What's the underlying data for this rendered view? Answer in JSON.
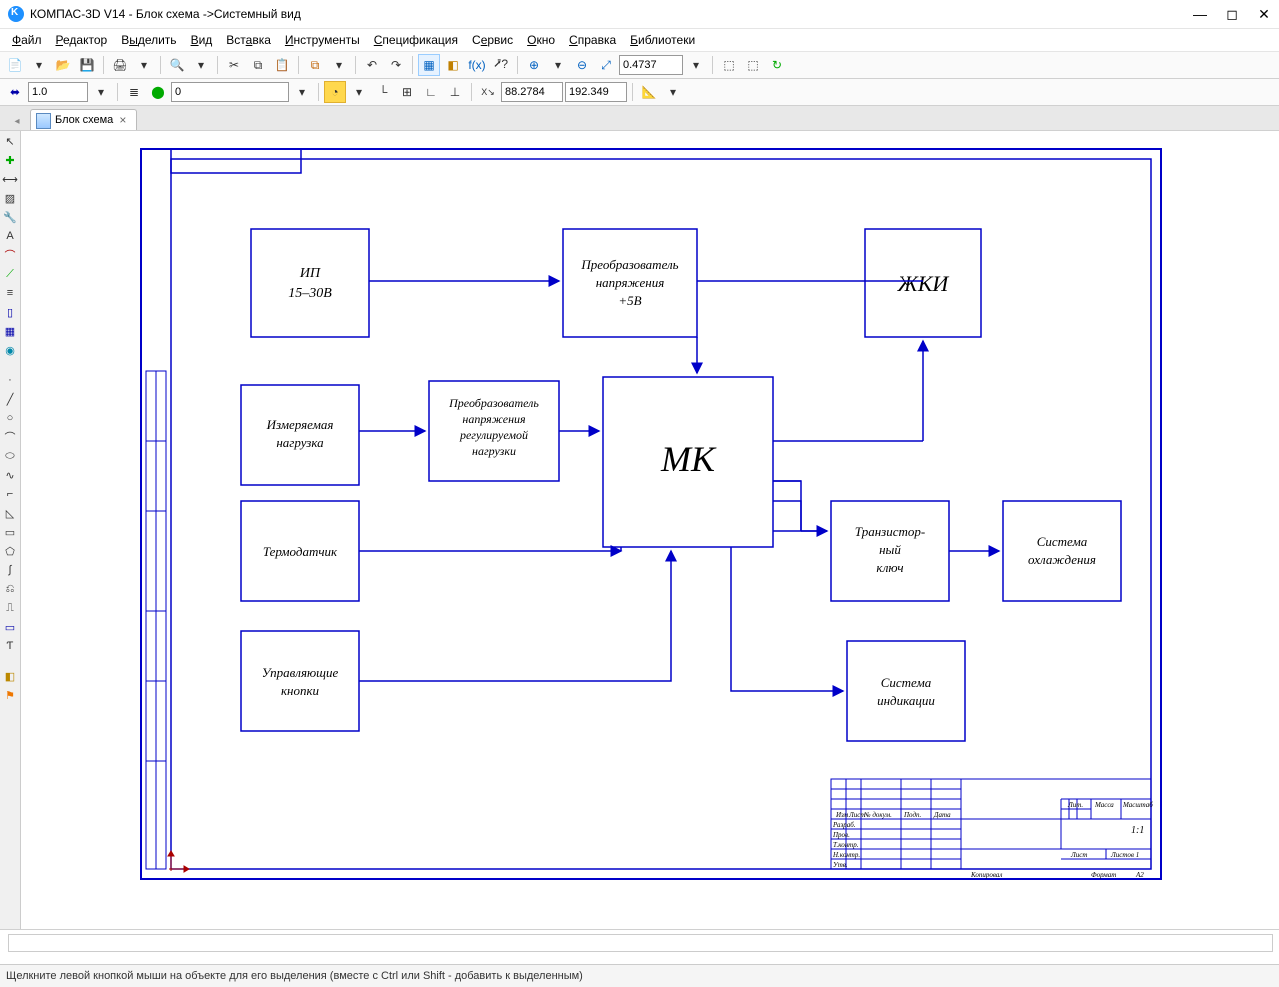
{
  "window": {
    "title": "КОМПАС-3D V14 - Блок схема ->Системный вид"
  },
  "menu": {
    "items": [
      "Файл",
      "Редактор",
      "Выделить",
      "Вид",
      "Вставка",
      "Инструменты",
      "Спецификация",
      "Сервис",
      "Окно",
      "Справка",
      "Библиотеки"
    ]
  },
  "toolbar1": {
    "zoom_value": "0.4737"
  },
  "toolbar2": {
    "scale_value": "1.0",
    "layer_value": "0",
    "coord_x": "88.2784",
    "coord_y": "192.349"
  },
  "tab": {
    "label": "Блок схема"
  },
  "diagram": {
    "blocks": {
      "ip": {
        "l1": "ИП",
        "l2": "15–30В"
      },
      "conv5": {
        "l1": "Преобразователь",
        "l2": "напряжения",
        "l3": "+5В"
      },
      "lcd": {
        "l1": "ЖКИ"
      },
      "load": {
        "l1": "Измеряемая",
        "l2": "нагрузка"
      },
      "convr": {
        "l1": "Преобразователь",
        "l2": "напряжения",
        "l3": "регулируемой",
        "l4": "нагрузки"
      },
      "mk": {
        "l1": "МК"
      },
      "therm": {
        "l1": "Термодатчик"
      },
      "tkey": {
        "l1": "Транзистор-",
        "l2": "ный",
        "l3": "ключ"
      },
      "cool": {
        "l1": "Система",
        "l2": "охлаждения"
      },
      "btns": {
        "l1": "Управляющие",
        "l2": "кнопки"
      },
      "ind": {
        "l1": "Система",
        "l2": "индикации"
      }
    },
    "titleblock": {
      "h_izm": "Изм",
      "h_list": "Лист",
      "h_ndok": "№ докум.",
      "h_podp": "Подп.",
      "h_data": "Дата",
      "r_razr": "Разраб.",
      "r_prov": "Пров.",
      "r_tkont": "Т.контр.",
      "r_nkont": "Н.контр.",
      "r_utv": "Утв.",
      "lit": "Лит.",
      "massa": "Масса",
      "masst": "Масштаб",
      "scale": "1:1",
      "list": "Лист",
      "listov": "Листов  1",
      "kopir": "Копировал",
      "format": "Формат",
      "fmt": "A2"
    }
  },
  "status": {
    "text": "Щелкните левой кнопкой мыши на объекте для его выделения (вместе с Ctrl или Shift - добавить к выделенным)"
  }
}
